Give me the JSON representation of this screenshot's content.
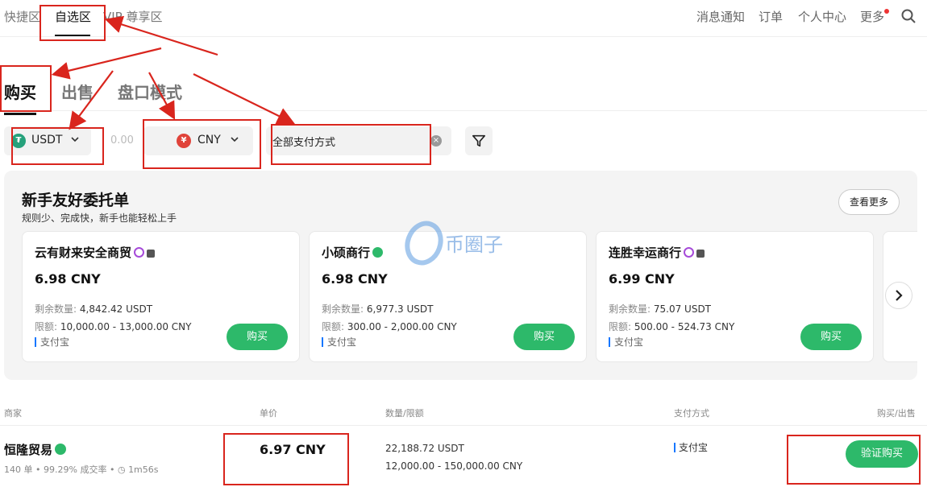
{
  "top_nav": {
    "tabs": [
      "快捷区",
      "自选区",
      "VIP 尊享区"
    ],
    "active_tab": "自选区",
    "right_links": [
      "消息通知",
      "订单",
      "个人中心",
      "更多"
    ]
  },
  "trade_tabs": {
    "items": [
      "购买",
      "出售",
      "盘口模式"
    ],
    "active": "购买"
  },
  "filters": {
    "crypto": "USDT",
    "amount_placeholder": "0.00",
    "fiat": "CNY",
    "fiat_symbol": "¥",
    "payment": "全部支付方式"
  },
  "promo": {
    "title": "新手友好委托单",
    "subtitle": "规则少、完成快，新手也能轻松上手",
    "more_label": "查看更多",
    "remaining_label": "剩余数量:",
    "limit_label": "限额:",
    "cards": [
      {
        "name": "云有财来安全商贸",
        "price": "6.98 CNY",
        "remaining": "4,842.42 USDT",
        "limit": "10,000.00 - 13,000.00 CNY",
        "payment": "支付宝",
        "button": "购买"
      },
      {
        "name": "小硕商行",
        "price": "6.98 CNY",
        "remaining": "6,977.3 USDT",
        "limit": "300.00 - 2,000.00 CNY",
        "payment": "支付宝",
        "button": "购买"
      },
      {
        "name": "连胜幸运商行",
        "price": "6.99 CNY",
        "remaining": "75.07 USDT",
        "limit": "500.00 - 524.73 CNY",
        "payment": "支付宝",
        "button": "购买"
      }
    ]
  },
  "watermark": "币圈子",
  "table": {
    "headers": [
      "商家",
      "单价",
      "数量/限额",
      "支付方式",
      "购买/出售"
    ],
    "rows": [
      {
        "merchant": "恒隆贸易",
        "orders": "140 单",
        "completion": "99.29% 成交率",
        "time": "1m56s",
        "price": "6.97 CNY",
        "quantity": "22,188.72 USDT",
        "limit": "12,000.00 - 150,000.00 CNY",
        "payment": "支付宝",
        "action": "验证购买"
      }
    ]
  },
  "colors": {
    "accent_green": "#2db96a",
    "annotation_red": "#d9251d",
    "usdt_teal": "#26a17b",
    "cny_red": "#e0433a"
  }
}
